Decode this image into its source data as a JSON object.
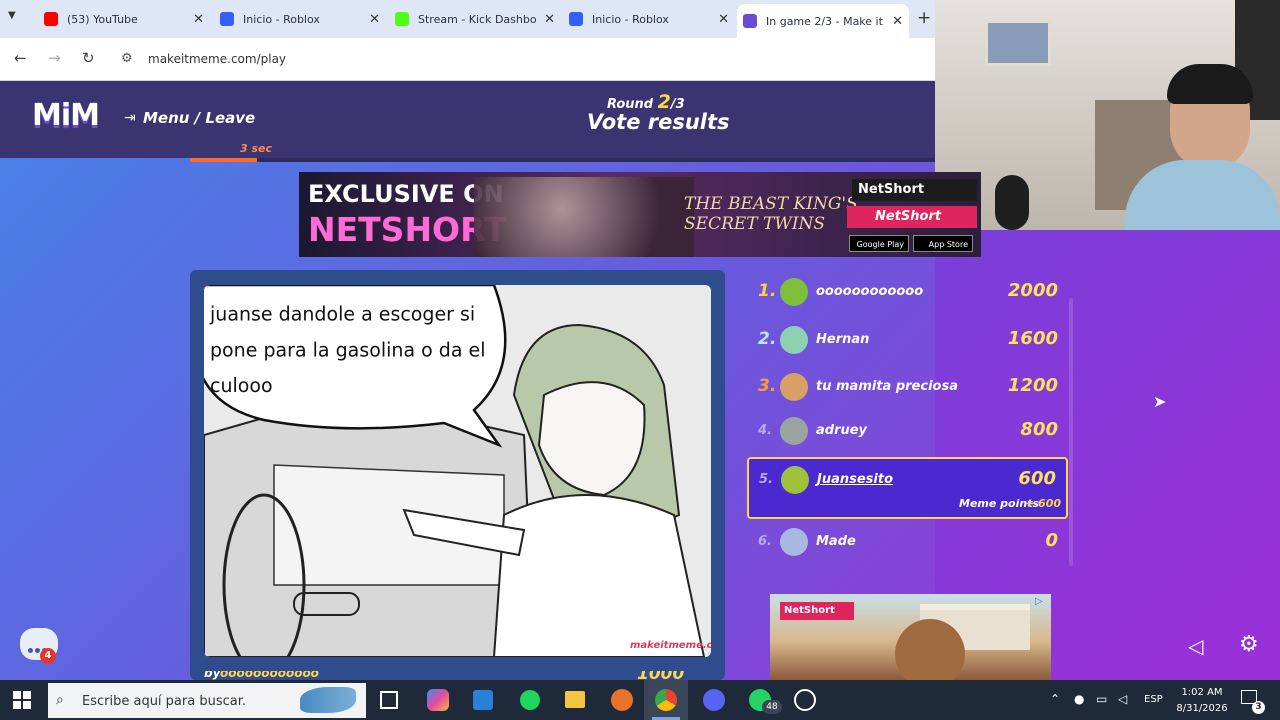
{
  "browser": {
    "tabs": [
      {
        "title": "(53) YouTube",
        "icon": "youtube-icon",
        "color": "#ff0000"
      },
      {
        "title": "Inicio - Roblox",
        "icon": "roblox-icon",
        "color": "#335fff"
      },
      {
        "title": "Stream - Kick Dashbo",
        "icon": "kick-icon",
        "color": "#53fc18"
      },
      {
        "title": "Inicio - Roblox",
        "icon": "roblox-icon",
        "color": "#335fff"
      },
      {
        "title": "In game 2/3 - Make it",
        "icon": "makeitmeme-icon",
        "color": "#6a4bd8"
      }
    ],
    "url": "makeitmeme.com/play"
  },
  "game": {
    "logo": "MiM",
    "menu_label": "Menu / Leave",
    "round_label": "Round",
    "round_current": "2",
    "round_total": "/3",
    "title": "Vote results",
    "timer": "3 sec",
    "timer_progress": 0.09
  },
  "ad_banner": {
    "line1": "EXCLUSIVE ON",
    "line2": "NETSHORT",
    "title": "THE BEAST KING'S SECRET TWINS",
    "brand": "NetShort",
    "google_play": "Google Play",
    "app_store": "App Store"
  },
  "meme": {
    "caption": "juanse dandole a escoger si pone para la gasolina o da el culooo",
    "watermark": "makeitmeme.com",
    "author_prefix": "by",
    "author": "oooooooooooo",
    "points": "1000"
  },
  "leaderboard": [
    {
      "rank": "1.",
      "name": "oooooooooooo",
      "score": "2000",
      "rank_color": "#ffcf3a",
      "avatar_color": "#7ec03a"
    },
    {
      "rank": "2.",
      "name": "Hernan",
      "score": "1600",
      "rank_color": "#bfe6ff",
      "avatar_color": "#8fd0b0"
    },
    {
      "rank": "3.",
      "name": "tu mamita preciosa",
      "score": "1200",
      "rank_color": "#ff9a3a",
      "avatar_color": "#d9a066"
    },
    {
      "rank": "4.",
      "name": "adruey",
      "score": "800",
      "rank_color": "#b9a9e8",
      "avatar_color": "#9aa5a0"
    },
    {
      "rank": "5.",
      "name": "Juansesito",
      "score": "600",
      "rank_color": "#b9a9e8",
      "avatar_color": "#a0c23a",
      "meme_points_label": "Meme points",
      "meme_points": "+ 600"
    },
    {
      "rank": "6.",
      "name": "Made",
      "score": "0",
      "rank_color": "#b9a9e8",
      "avatar_color": "#a9b8e0"
    }
  ],
  "ad_small": {
    "brand": "NetShort"
  },
  "chat": {
    "badge": "4"
  },
  "taskbar": {
    "search_placeholder": "Escribe aquí para buscar.",
    "whatsapp_badge": "48",
    "language": "ESP",
    "time": "1:02 AM",
    "date": "8/31/2026",
    "notification_count": "3"
  }
}
